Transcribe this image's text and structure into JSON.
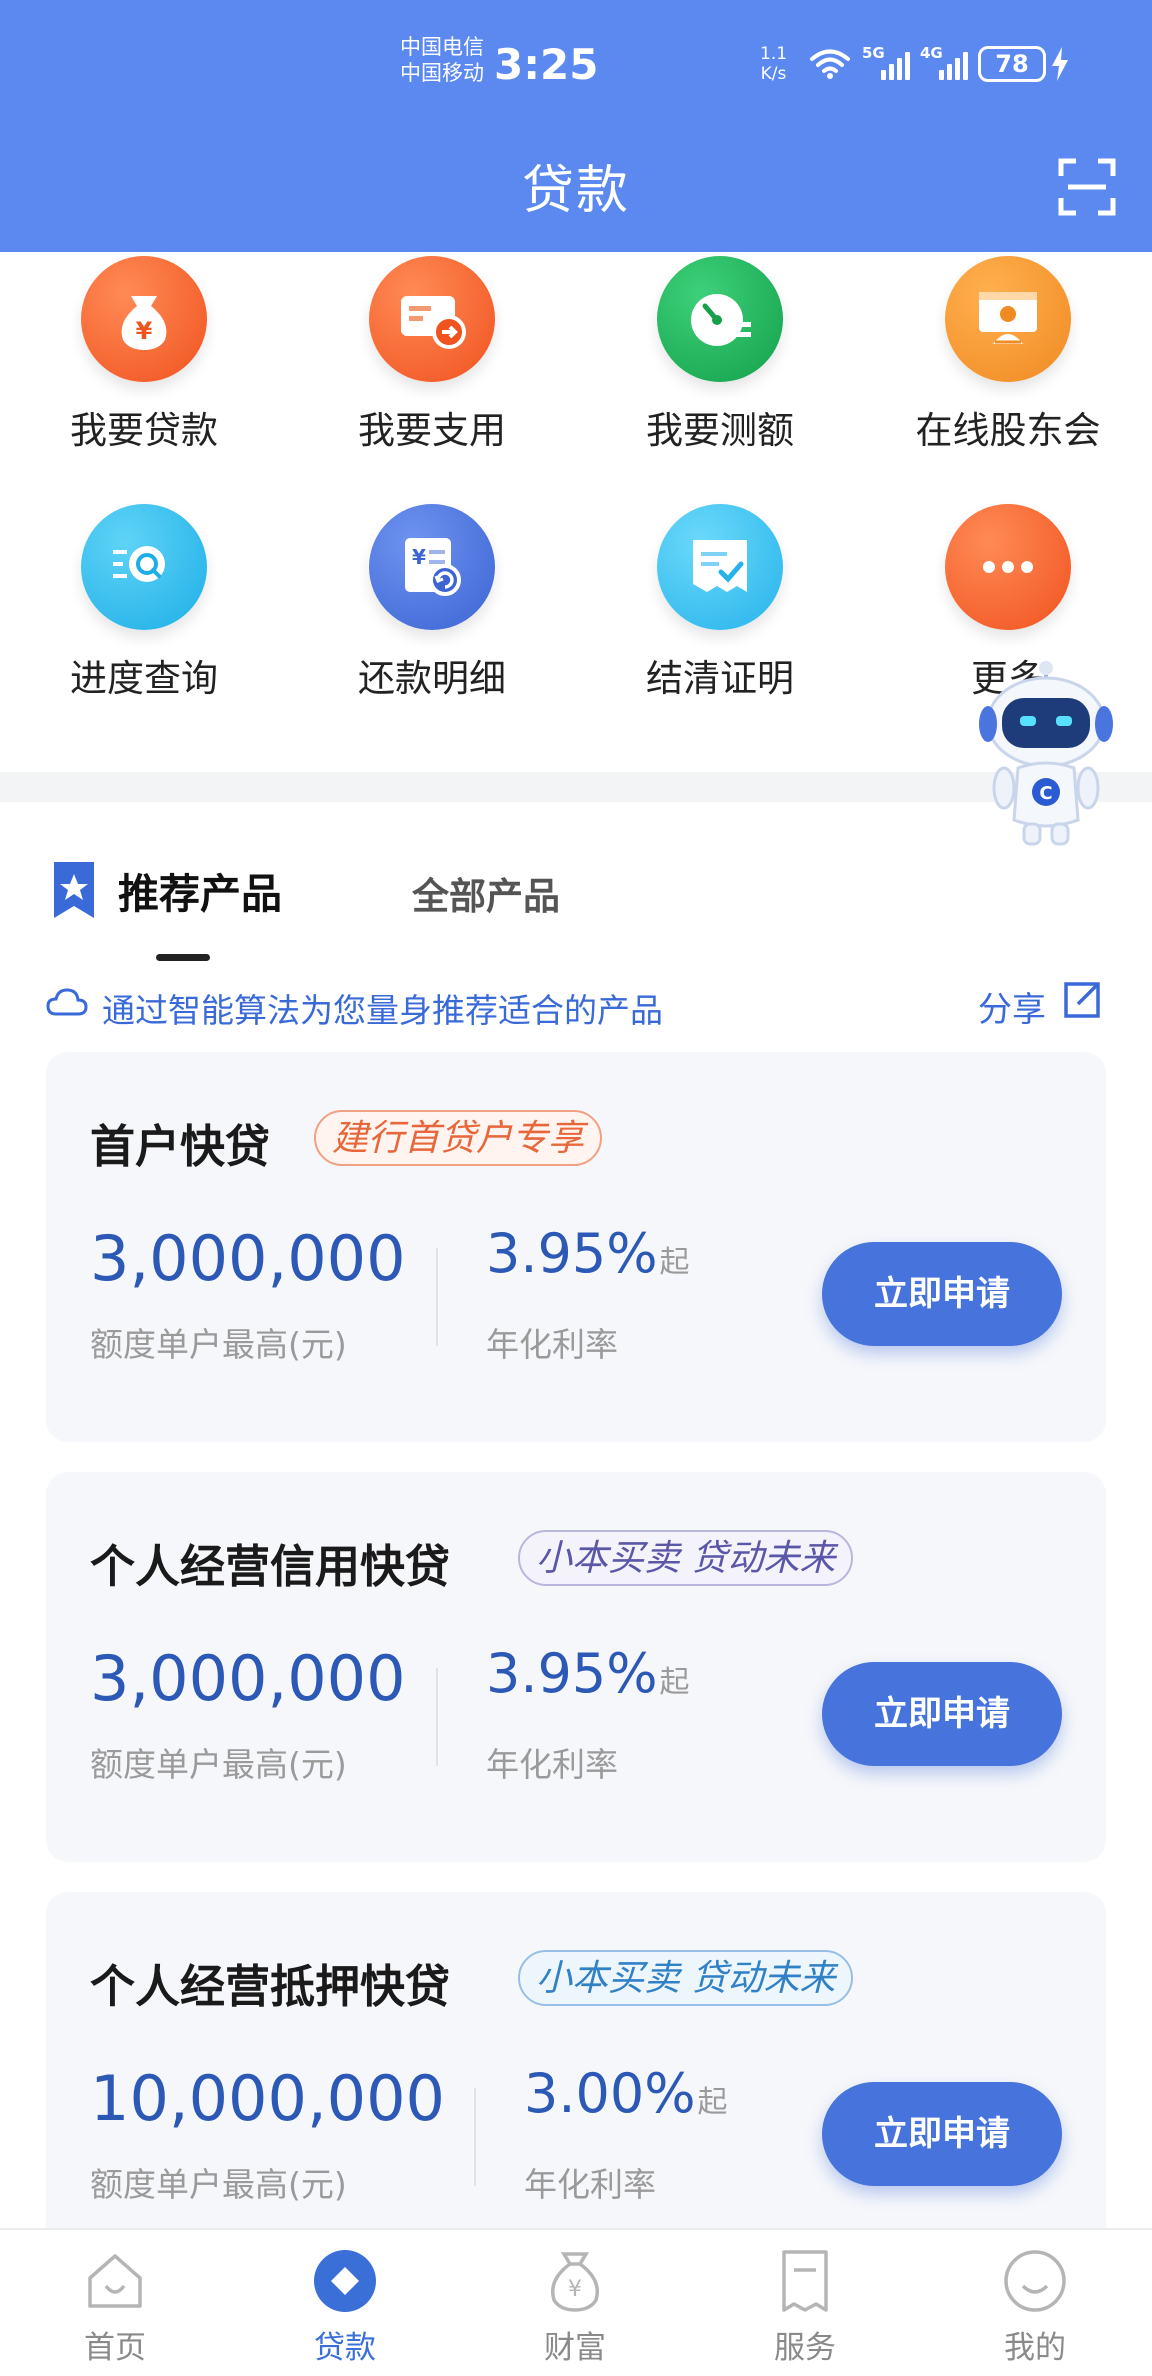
{
  "status_bar": {
    "carrier_1": "中国电信",
    "carrier_2": "中国移动",
    "time": "3:25",
    "net_speed_value": "1.1",
    "net_speed_unit": "K/s",
    "signal_1": "5G",
    "signal_2": "4G",
    "battery": "78"
  },
  "header": {
    "title": "贷款",
    "scan_icon": "scan-icon"
  },
  "quick_actions": [
    {
      "label": "我要贷款",
      "icon": "money-bag-icon",
      "color": "#f2622f"
    },
    {
      "label": "我要支用",
      "icon": "card-transfer-icon",
      "color": "#f2622f"
    },
    {
      "label": "我要测额",
      "icon": "gauge-icon",
      "color": "#1fae57"
    },
    {
      "label": "在线股东会",
      "icon": "meeting-icon",
      "color": "#f79331"
    },
    {
      "label": "进度查询",
      "icon": "search-doc-icon",
      "color": "#2cb4ea"
    },
    {
      "label": "还款明细",
      "icon": "repay-icon",
      "color": "#4a74de"
    },
    {
      "label": "结清证明",
      "icon": "certificate-icon",
      "color": "#35b9ec"
    },
    {
      "label": "更多",
      "icon": "more-icon",
      "color": "#f2622f"
    }
  ],
  "tabs": {
    "recommended": "推荐产品",
    "all": "全部产品"
  },
  "hint": {
    "text": "通过智能算法为您量身推荐适合的产品",
    "share": "分享"
  },
  "products": [
    {
      "name": "首户快贷",
      "tag": "建行首贷户专享",
      "amount": "3,000,000",
      "amount_label": "额度单户最高(元)",
      "rate": "3.95%",
      "rate_suffix": "起",
      "rate_label": "年化利率",
      "button": "立即申请"
    },
    {
      "name": "个人经营信用快贷",
      "tag": "小本买卖 贷动未来",
      "amount": "3,000,000",
      "amount_label": "额度单户最高(元)",
      "rate": "3.95%",
      "rate_suffix": "起",
      "rate_label": "年化利率",
      "button": "立即申请"
    },
    {
      "name": "个人经营抵押快贷",
      "tag": "小本买卖 贷动未来",
      "amount": "10,000,000",
      "amount_label": "额度单户最高(元)",
      "rate": "3.00%",
      "rate_suffix": "起",
      "rate_label": "年化利率",
      "button": "立即申请"
    }
  ],
  "bottom_nav": [
    {
      "label": "首页",
      "icon": "home-icon"
    },
    {
      "label": "贷款",
      "icon": "loan-icon",
      "active": true
    },
    {
      "label": "财富",
      "icon": "wealth-bag-icon"
    },
    {
      "label": "服务",
      "icon": "service-receipt-icon"
    },
    {
      "label": "我的",
      "icon": "profile-icon"
    }
  ],
  "colors": {
    "brand_blue": "#5b89f0",
    "button_blue": "#4673dc",
    "amount_blue": "#2c59b5"
  }
}
